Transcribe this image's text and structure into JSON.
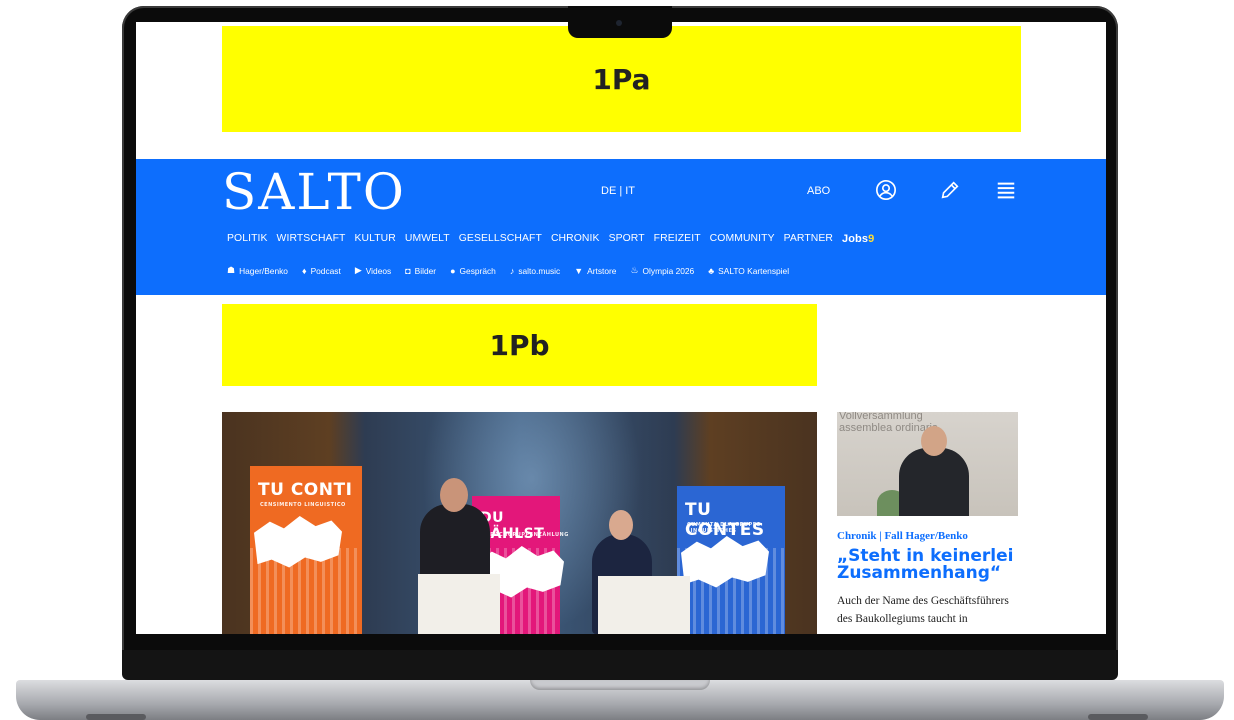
{
  "ads": {
    "top": "1Pa",
    "middle": "1Pb"
  },
  "header": {
    "logo": "SALTO",
    "lang": "DE | IT",
    "abo": "ABO",
    "colors": {
      "brand": "#0d6efd",
      "ad": "#ffff00"
    }
  },
  "nav_main": [
    "POLITIK",
    "WIRTSCHAFT",
    "KULTUR",
    "UMWELT",
    "GESELLSCHAFT",
    "CHRONIK",
    "SPORT",
    "FREIZEIT",
    "COMMUNITY",
    "PARTNER"
  ],
  "nav_jobs": {
    "label": "Jobs",
    "mark": "9"
  },
  "nav_sub": [
    {
      "icon": "☗",
      "label": "Hager/Benko"
    },
    {
      "icon": "♦",
      "label": "Podcast"
    },
    {
      "icon": "▶",
      "label": "Videos"
    },
    {
      "icon": "◘",
      "label": "Bilder"
    },
    {
      "icon": "●",
      "label": "Gespräch"
    },
    {
      "icon": "♪",
      "label": "salto.music"
    },
    {
      "icon": "▼",
      "label": "Artstore"
    },
    {
      "icon": "♨",
      "label": "Olympia 2026"
    },
    {
      "icon": "♣",
      "label": "SALTO Kartenspiel"
    }
  ],
  "hero": {
    "banners": [
      "TU CONTI",
      "DU ZÄHLST",
      "TU CONTES"
    ],
    "banner_subs": [
      "CENSIMENTO LINGUISTICO",
      "SPRACHGRUPPENZÄHLUNG",
      "CUMPUTA DLA GRUPES LINGUISTICHES"
    ]
  },
  "side": {
    "image_text": "Vollversammlung\nassemblea ordinaria",
    "kicker": "Chronik | Fall Hager/Benko",
    "headline": "„Steht in keinerlei Zusammenhang“",
    "teaser": "Auch der Name des Geschäftsführers des Baukollegiums taucht in"
  }
}
